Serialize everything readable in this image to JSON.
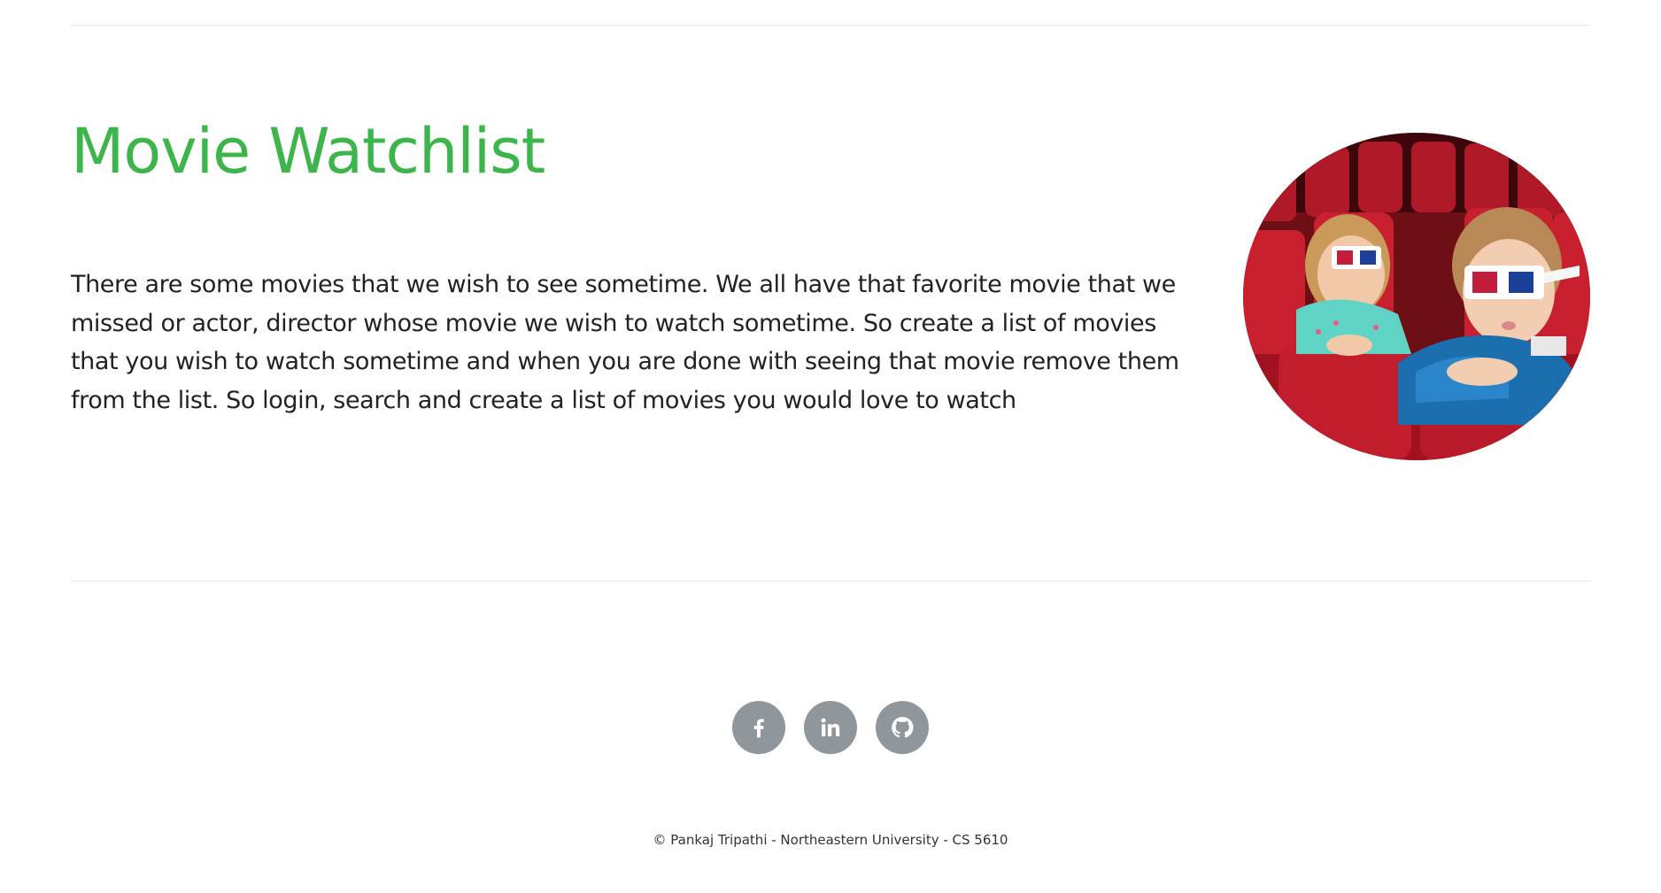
{
  "hero": {
    "title": "Movie Watchlist",
    "description": "There are some movies that we wish to see sometime. We all have that favorite movie that we missed or actor, director whose movie we wish to watch sometime. So create a list of movies that you wish to watch sometime and when you are done with seeing that movie remove them from the list. So login, search and create a list of movies you would love to watch",
    "image": "children-in-cinema-with-3d-glasses"
  },
  "social": {
    "items": [
      {
        "icon": "facebook-icon"
      },
      {
        "icon": "linkedin-icon"
      },
      {
        "icon": "github-icon"
      }
    ]
  },
  "footer": {
    "copyright": "© Pankaj Tripathi - Northeastern University - CS 5610"
  },
  "colors": {
    "title": "#3cb54a",
    "social_bg": "#8f969c",
    "rule": "#e9e9e9",
    "text": "#222222"
  }
}
